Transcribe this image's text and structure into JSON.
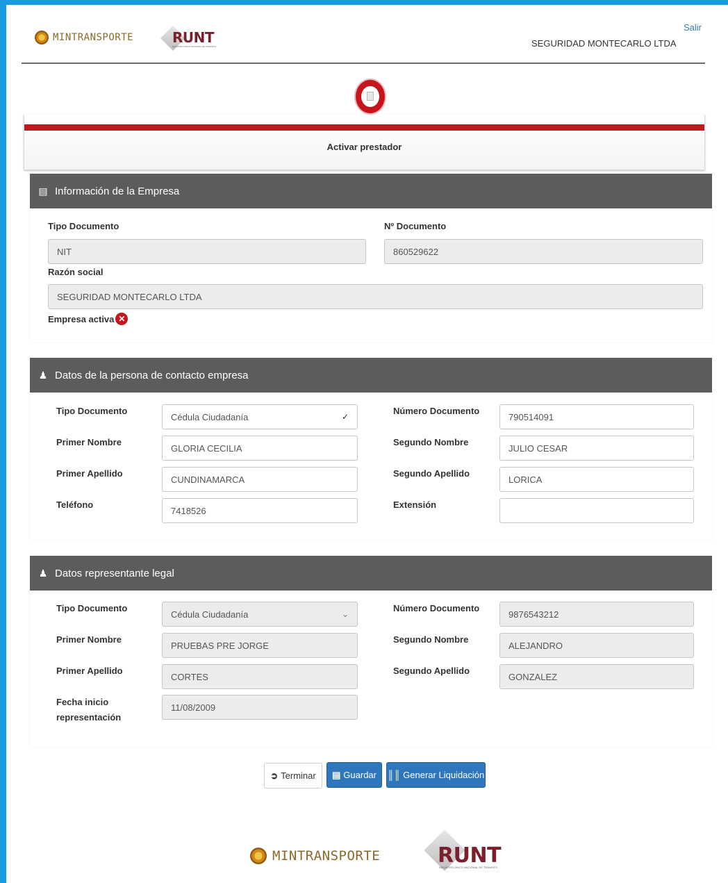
{
  "header": {
    "mintransporte": "MINTRANSPORTE",
    "runt": "RUNT",
    "runt_sub": "REGISTRO ÚNICO NACIONAL DE TRÁNSITO",
    "logout": "Salir",
    "company": "SEGURIDAD MONTECARLO LTDA"
  },
  "step": {
    "label": "Activar prestador"
  },
  "empresa": {
    "title": "Información de la Empresa",
    "tipo_documento_label": "Tipo Documento",
    "tipo_documento_value": "NIT",
    "numero_documento_label": "Nº Documento",
    "numero_documento_value": "860529622",
    "razon_social_label": "Razón social",
    "razon_social_value": "SEGURIDAD MONTECARLO LTDA",
    "activa_label": "Empresa activa"
  },
  "contacto": {
    "title": "Datos de la persona de contacto empresa",
    "tipo_documento_label": "Tipo Documento",
    "tipo_documento_value": "Cédula Ciudadanía",
    "numero_documento_label": "Número Documento",
    "numero_documento_value": "790514091",
    "primer_nombre_label": "Primer Nombre",
    "primer_nombre_value": "GLORIA CECILIA",
    "segundo_nombre_label": "Segundo Nombre",
    "segundo_nombre_value": "JULIO CESAR",
    "primer_apellido_label": "Primer Apellido",
    "primer_apellido_value": "CUNDINAMARCA",
    "segundo_apellido_label": "Segundo Apellido",
    "segundo_apellido_value": "LORICA",
    "telefono_label": "Teléfono",
    "telefono_value": "7418526",
    "extension_label": "Extensión",
    "extension_value": ""
  },
  "representante": {
    "title": "Datos representante legal",
    "tipo_documento_label": "Tipo Documento",
    "tipo_documento_value": "Cédula Ciudadanía",
    "numero_documento_label": "Número Documento",
    "numero_documento_value": "9876543212",
    "primer_nombre_label": "Primer Nombre",
    "primer_nombre_value": "PRUEBAS PRE JORGE",
    "segundo_nombre_label": "Segundo Nombre",
    "segundo_nombre_value": "ALEJANDRO",
    "primer_apellido_label": "Primer Apellido",
    "primer_apellido_value": "CORTES",
    "segundo_apellido_label": "Segundo Apellido",
    "segundo_apellido_value": "GONZALEZ",
    "fecha_inicio_label_1": "Fecha inicio",
    "fecha_inicio_label_2": "representación",
    "fecha_inicio_value": "11/08/2009"
  },
  "actions": {
    "terminar": "Terminar",
    "guardar": "Guardar",
    "generar": "Generar Liquidación"
  },
  "footer": {
    "mintransporte": "MINTRANSPORTE",
    "runt": "RUNT",
    "runt_sub": "REGISTRO ÚNICO NACIONAL DE TRÁNSITO"
  },
  "icons": {
    "document": "list-icon",
    "user": "user-icon",
    "inactive": "x-circle-icon",
    "exit": "exit-icon",
    "save": "save-icon",
    "barcode": "barcode-icon"
  },
  "colors": {
    "frame": "#1a9be0",
    "accent_red": "#c4161c",
    "panel_header": "#5c5c5c",
    "primary_button": "#2e77bd"
  }
}
